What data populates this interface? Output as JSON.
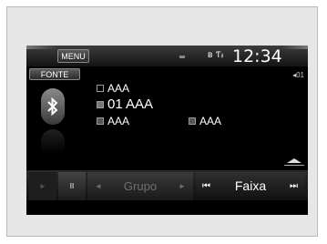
{
  "header": {
    "menu_label": "MENU",
    "clock": "12:34",
    "bt_icon": "bluetooth-status-icon",
    "signal_icon": "signal-strength-icon"
  },
  "source": {
    "button_label": "FONTE",
    "track_indicator": "01"
  },
  "track_info": {
    "folder": "AAA",
    "track": "01 AAA",
    "artist": "AAA",
    "album": "AAA"
  },
  "controls": {
    "play_glyph": "►",
    "pause_glyph": "II",
    "group_label": "Grupo",
    "group_prev_glyph": "◄",
    "group_next_glyph": "►",
    "track_label": "Faixa",
    "track_prev_glyph": "⏮",
    "track_next_glyph": "⏭"
  }
}
